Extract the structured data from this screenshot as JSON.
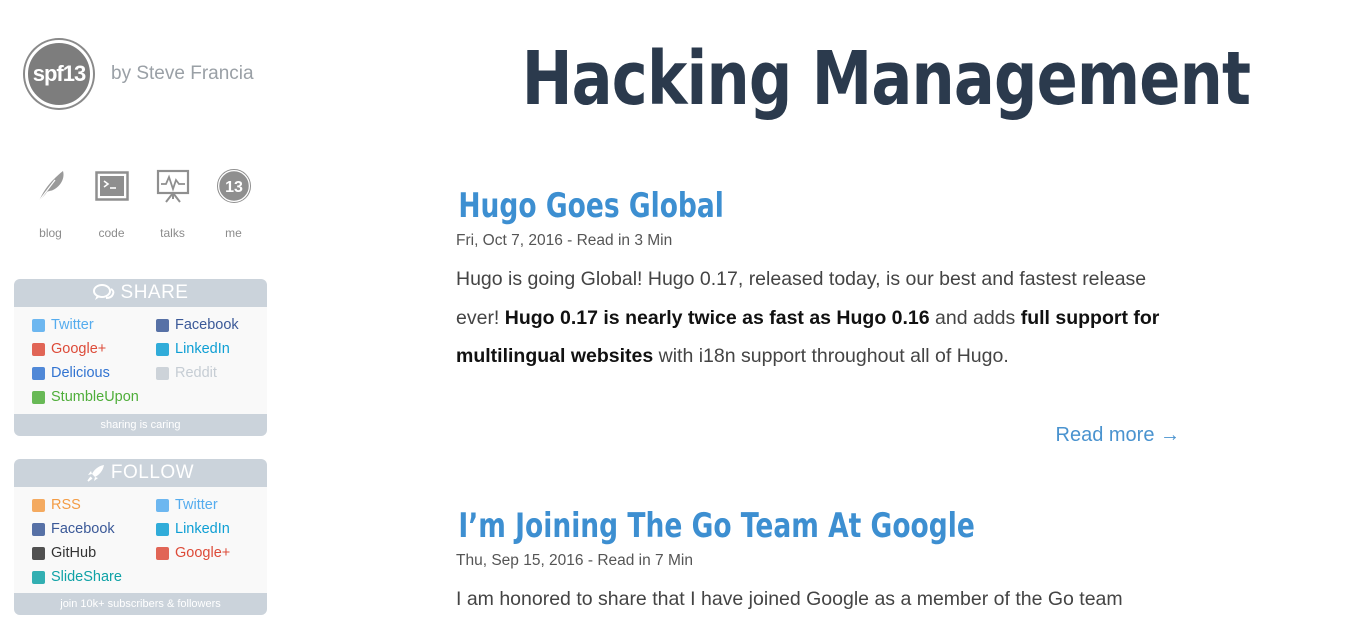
{
  "brand": {
    "logo_text": "spf13",
    "byline": "by Steve Francia"
  },
  "nav": [
    {
      "label": "blog",
      "icon": "feather-icon"
    },
    {
      "label": "code",
      "icon": "terminal-icon"
    },
    {
      "label": "talks",
      "icon": "presentation-icon"
    },
    {
      "label": "me",
      "icon": "spf13-badge-icon"
    }
  ],
  "share": {
    "title": "SHARE",
    "links": [
      {
        "label": "Twitter",
        "color": "#55acee"
      },
      {
        "label": "Facebook",
        "color": "#3b5998"
      },
      {
        "label": "Google+",
        "color": "#dd4b39"
      },
      {
        "label": "LinkedIn",
        "color": "#0e9fd4"
      },
      {
        "label": "Delicious",
        "color": "#3274d1"
      },
      {
        "label": "Reddit",
        "color": "#c6cdd4"
      },
      {
        "label": "StumbleUpon",
        "color": "#4fae3a"
      }
    ],
    "footer": "sharing is caring"
  },
  "follow": {
    "title": "FOLLOW",
    "links": [
      {
        "label": "RSS",
        "color": "#f39c45"
      },
      {
        "label": "Twitter",
        "color": "#55acee"
      },
      {
        "label": "Facebook",
        "color": "#3b5998"
      },
      {
        "label": "LinkedIn",
        "color": "#0e9fd4"
      },
      {
        "label": "GitHub",
        "color": "#333333"
      },
      {
        "label": "Google+",
        "color": "#dd4b39"
      },
      {
        "label": "SlideShare",
        "color": "#0fa2a6"
      }
    ],
    "footer": "join 10k+ subscribers & followers"
  },
  "site_title": "Hacking Management",
  "posts": [
    {
      "title": "Hugo Goes Global",
      "meta": "Fri, Oct 7, 2016 - Read in 3 Min",
      "excerpt_parts": [
        {
          "text": "Hugo is going Global! Hugo 0.17, released today, is our best and fastest release ever! ",
          "bold": false
        },
        {
          "text": "Hugo 0.17 is nearly twice as fast as Hugo 0.16",
          "bold": true
        },
        {
          "text": " and adds ",
          "bold": false
        },
        {
          "text": "full support for multilingual websites",
          "bold": true
        },
        {
          "text": " with i18n support throughout all of Hugo.",
          "bold": false
        }
      ],
      "read_more": "Read more →"
    },
    {
      "title": "I’m Joining The Go Team At Google",
      "meta": "Thu, Sep 15, 2016 - Read in 7 Min",
      "excerpt_parts": [
        {
          "text": "I am honored to share that I have joined Google as a member of the Go team",
          "bold": false
        }
      ]
    }
  ]
}
